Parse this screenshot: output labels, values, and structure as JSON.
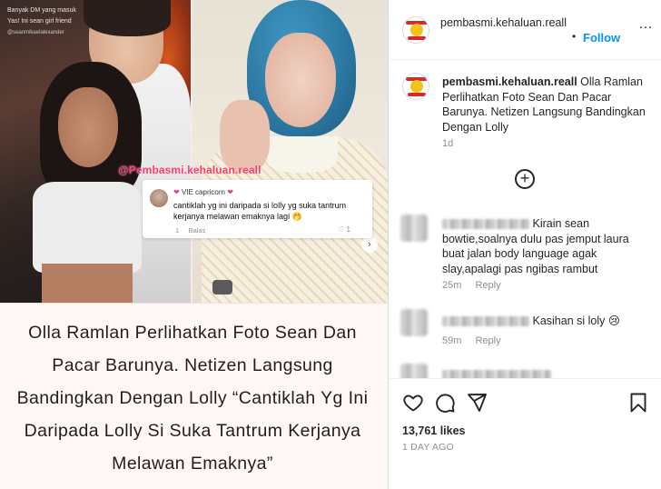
{
  "media": {
    "dm_header": "Banyak DM yang masuk",
    "dm_line": "Yas! Ini sean girl friend",
    "dm_handle": "@seanmikaelalexander",
    "watermark": "@Pembasmi.kehaluan.reall",
    "comment_card": {
      "username": "VIE capricorn",
      "text": "cantiklah yg ini daripada si lolly yg suka tantrum kerjanya melawan emaknya lagi 🤭",
      "time": "1",
      "reply_label": "Balas",
      "likes": "1"
    },
    "next_icon": "chevron-right-icon",
    "caption_text": "Olla Ramlan Perlihatkan Foto Sean Dan Pacar Barunya. Netizen Langsung Bandingkan Dengan Lolly  “Cantiklah Yg Ini Daripada Lolly Si Suka Tantrum Kerjanya Melawan Emaknya”"
  },
  "header": {
    "username": "pembasmi.kehaluan.reall",
    "separator": "•",
    "follow_label": "Follow",
    "more_label": "…"
  },
  "caption": {
    "username": "pembasmi.kehaluan.reall",
    "text": "Olla Ramlan Perlihatkan Foto Sean Dan Pacar Barunya. Netizen Langsung Bandingkan Dengan Lolly",
    "time": "1d"
  },
  "load_more_icon": "plus-circle-icon",
  "comments": [
    {
      "text": "Kirain sean bowtie,soalnya dulu pas jemput laura buat jalan body language agak slay,apalagi pas ngibas rambut",
      "time": "25m",
      "reply_label": "Reply"
    },
    {
      "text": "Kasihan si loly 😢",
      "time": "59m",
      "reply_label": "Reply"
    }
  ],
  "actions": {
    "icons": [
      "heart-icon",
      "comment-icon",
      "share-icon",
      "bookmark-icon"
    ],
    "likes": "13,761 likes",
    "age": "1 DAY AGO"
  },
  "colors": {
    "link_blue": "#0095f6",
    "watermark_pink": "#ff3a6e",
    "caption_bg": "#fff6f6"
  }
}
